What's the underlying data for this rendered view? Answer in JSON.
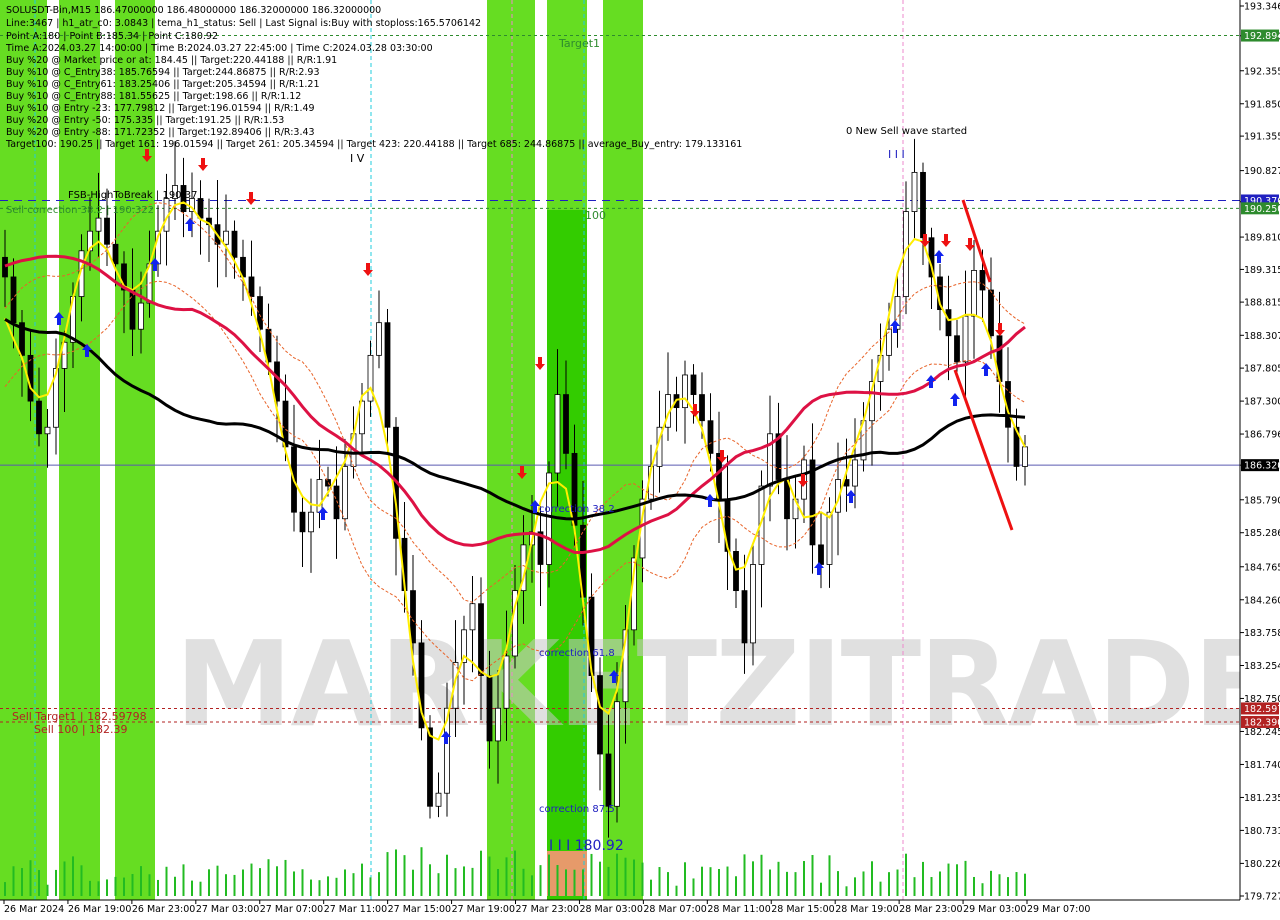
{
  "chart_data": {
    "type": "candlestick",
    "symbol": "SOLUSDT-Bin",
    "timeframe": "M15",
    "info_lines": [
      "SOLUSDT-Bin,M15  186.47000000 186.48000000 186.32000000 186.32000000",
      "Line:3467  |  h1_atr_c0: 3.0843  |  tema_h1_status: Sell  |  Last Signal is:Buy with stoploss:165.5706142",
      "Point A:180  |  Point B:185.34  |  Point C:180.92",
      "Time A:2024.03.27 14:00:00  |  Time B:2024.03.27 22:45:00  |  Time C:2024.03.28 03:30:00",
      "Buy %20 @ Market price or at: 184.45  ||  Target:220.44188  ||  R/R:1.91",
      "Buy %10 @ C_Entry38: 185.76594  ||  Target:244.86875  ||  R/R:2.93",
      "Buy %10 @ C_Entry61: 183.25406  ||  Target:205.34594  ||  R/R:1.21",
      "Buy %10 @ C_Entry88: 181.55625  ||  Target:198.66  ||  R/R:1.12",
      "Buy %10 @ Entry -23: 177.79812  ||  Target:196.01594  ||  R/R:1.49",
      "Buy %20 @ Entry -50: 175.335  ||  Target:191.25  ||  R/R:1.53",
      "Buy %20 @ Entry -88: 171.72352  ||  Target:192.89406  ||  R/R:3.43",
      "Target100: 190.25  ||  Target 161: 196.01594  ||  Target 261: 205.34594  ||  Target 423: 220.44188  ||  Target 685: 244.86875  ||  average_Buy_entry: 179.133161"
    ],
    "y_ticks": [
      "193.346",
      "192.890",
      "192.355",
      "191.850",
      "191.355",
      "190.827",
      "190.350",
      "189.810",
      "189.315",
      "188.815",
      "188.307",
      "187.805",
      "187.300",
      "186.796",
      "186.320",
      "185.790",
      "185.286",
      "184.765",
      "184.260",
      "183.758",
      "183.254",
      "182.750",
      "182.245",
      "181.740",
      "181.235",
      "180.731",
      "180.226",
      "179.727"
    ],
    "ylim": [
      179.727,
      193.346
    ],
    "x_labels": [
      "26 Mar 2024",
      "26 Mar 19:00",
      "26 Mar 23:00",
      "27 Mar 03:00",
      "27 Mar 07:00",
      "27 Mar 11:00",
      "27 Mar 15:00",
      "27 Mar 19:00",
      "27 Mar 23:00",
      "28 Mar 03:00",
      "28 Mar 07:00",
      "28 Mar 11:00",
      "28 Mar 15:00",
      "28 Mar 19:00",
      "28 Mar 23:00",
      "29 Mar 03:00",
      "29 Mar 07:00"
    ],
    "price_tags": [
      {
        "value": 192.894,
        "label": "192.894",
        "color": "#2e8b2e"
      },
      {
        "value": 190.37,
        "label": "190.370",
        "color": "#2020c0"
      },
      {
        "value": 190.25,
        "label": "190.250",
        "color": "#2e8b2e"
      },
      {
        "value": 186.32,
        "label": "186.320",
        "color": "#000000"
      },
      {
        "value": 182.597,
        "label": "182.597",
        "color": "#b22222"
      },
      {
        "value": 182.39,
        "label": "182.390",
        "color": "#b22222"
      }
    ],
    "horizontal_lines": [
      {
        "value": 192.894,
        "color": "#2e8b2e",
        "dash": "3,3"
      },
      {
        "value": 190.37,
        "color": "#2020c0",
        "dash": "8,6"
      },
      {
        "value": 190.25,
        "color": "#2e8b2e",
        "dash": "3,3"
      },
      {
        "value": 186.32,
        "color": "#5a5ab0",
        "dash": ""
      },
      {
        "value": 182.597,
        "color": "#b22222",
        "dash": "3,3"
      },
      {
        "value": 182.39,
        "color": "#b22222",
        "dash": "3,3"
      }
    ],
    "annotations": {
      "fsb": "FSB-HighToBreak | 190.37",
      "sell_correction": "Sell correction 38.2 | 190.322",
      "sell_target1": "Sell Target1 | 182.59798",
      "sell_100": "Sell 100 | 182.39",
      "target1": "Target1",
      "hundred": "100",
      "new_wave": "0 New Sell wave started",
      "corr382": "correction 38.2",
      "corr618": "correction 61.8",
      "corr875": "correction 87.5",
      "c_label": "I I I 180.92",
      "b_label": "I V",
      "wave_mark": "I I I",
      "watermark": "MARKETZITRADE"
    },
    "close_path": [
      189.2,
      188.5,
      188.0,
      187.3,
      186.8,
      186.9,
      187.8,
      188.2,
      188.9,
      189.6,
      189.9,
      190.1,
      189.7,
      189.4,
      189.0,
      188.4,
      188.8,
      189.4,
      189.9,
      190.4,
      190.6,
      190.2,
      190.4,
      190.1,
      190.0,
      189.7,
      189.9,
      189.5,
      189.2,
      188.9,
      188.4,
      187.9,
      187.3,
      186.6,
      185.6,
      185.3,
      185.6,
      186.1,
      186.0,
      185.5,
      186.3,
      186.8,
      187.3,
      188.0,
      188.5,
      186.9,
      185.2,
      184.4,
      183.6,
      182.3,
      181.1,
      181.3,
      182.6,
      183.3,
      183.8,
      184.2,
      183.1,
      182.1,
      182.6,
      183.4,
      184.4,
      185.1,
      185.3,
      184.8,
      186.2,
      187.4,
      186.5,
      185.4,
      184.3,
      183.1,
      181.9,
      181.1,
      182.7,
      183.8,
      184.9,
      185.8,
      186.3,
      186.9,
      187.4,
      187.2,
      187.7,
      187.4,
      187.0,
      186.5,
      185.8,
      185.0,
      184.4,
      183.6,
      184.8,
      186.0,
      186.8,
      186.1,
      185.5,
      185.8,
      186.4,
      185.1,
      184.8,
      185.6,
      186.1,
      186.0,
      186.4,
      187.0,
      187.6,
      188.0,
      188.4,
      188.9,
      190.2,
      190.8,
      189.8,
      189.2,
      188.7,
      188.3,
      187.9,
      188.6,
      189.3,
      189.0,
      188.3,
      187.6,
      186.9,
      186.3,
      186.6
    ]
  }
}
